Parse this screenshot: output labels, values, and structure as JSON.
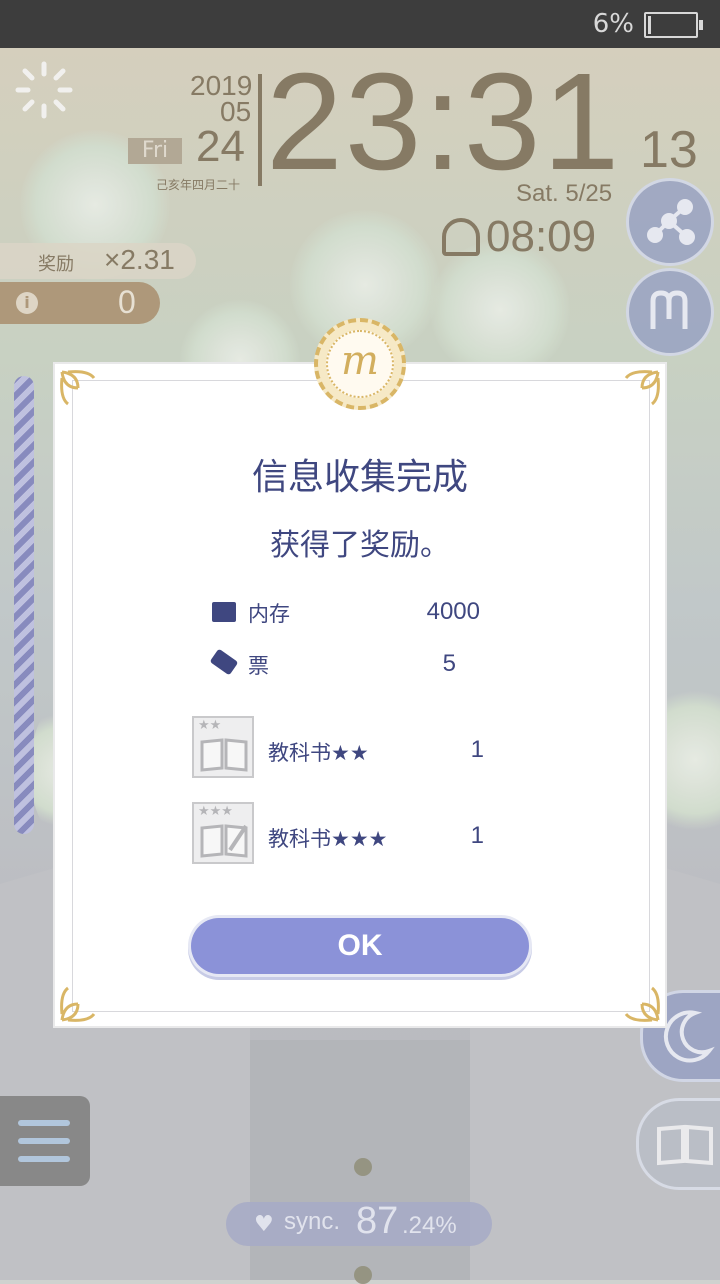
{
  "status_bar": {
    "battery_percent": "6%",
    "battery_level": 0.06
  },
  "clock": {
    "year": "2019",
    "month": "05",
    "day": "24",
    "weekday": "Fri",
    "lunar_date": "己亥年四月二十",
    "time": "23:31",
    "seconds": "13",
    "next_day": "Sat.  5/25",
    "alarm_time": "08:09"
  },
  "hud": {
    "reward_label": "奖励",
    "reward_multiplier": "×2.31",
    "info_count": "0",
    "info_icon_glyph": "i"
  },
  "sync": {
    "label": "sync.",
    "value_int": "87",
    "value_frac": ".24%"
  },
  "dialog": {
    "medal_letter": "m",
    "title": "信息收集完成",
    "subtitle": "获得了奖励。",
    "rewards": [
      {
        "icon": "memory-icon",
        "label": "内存",
        "value": "4000"
      },
      {
        "icon": "ticket-icon",
        "label": "票",
        "value": "5"
      }
    ],
    "items": [
      {
        "icon": "textbook-2star-icon",
        "stars": "★★",
        "label": "教科书★★",
        "count": "1"
      },
      {
        "icon": "textbook-3star-icon",
        "stars": "★★★",
        "label": "教科书★★★",
        "count": "1"
      }
    ],
    "ok_label": "OK"
  },
  "colors": {
    "dialog_text": "#3f4780",
    "ok_button": "#8b92d8",
    "clock_text": "#8a7d66",
    "medal_gold": "#d9b666"
  }
}
